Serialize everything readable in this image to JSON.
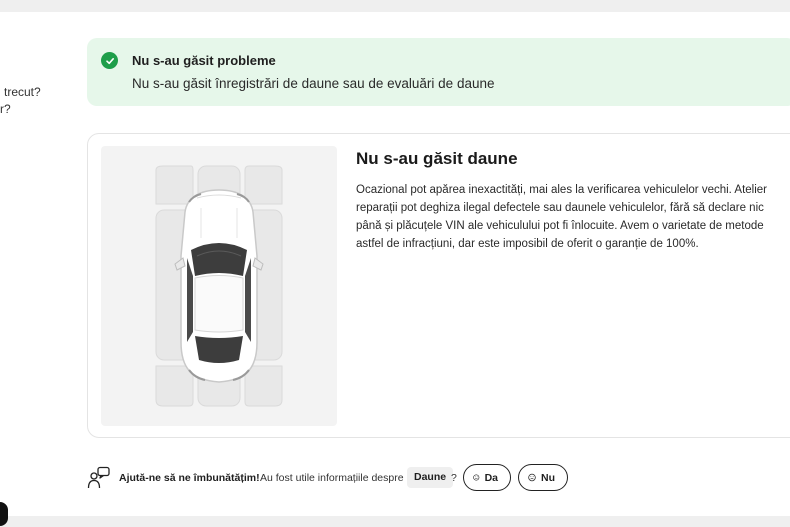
{
  "left_partial": {
    "line1": "n trecut?",
    "line2": "r?"
  },
  "alert": {
    "title": "Nu s-au găsit probleme",
    "text": "Nu s-au găsit înregistrări de daune sau de evaluări de daune",
    "accent": "#1e9e4a",
    "background": "#e6f7ea"
  },
  "card": {
    "title": "Nu s-au găsit daune",
    "lines": [
      "Ocazional pot apărea inexactități, mai ales la verificarea vehiculelor vechi. Atelier",
      "reparații pot deghiza ilegal defectele sau daunele vehiculelor, fără să declare nic",
      "până și plăcuțele VIN ale vehiculului pot fi înlocuite. Avem o varietate de metode",
      "astfel de infracțiuni, dar este imposibil de oferit o garanție de 100%."
    ]
  },
  "feedback": {
    "bold": "Ajută-ne să ne îmbunătățim!",
    "question": "Au fost utile informațiile despre",
    "chip": "Daune",
    "qmark": "?",
    "yes_label": "Da",
    "no_label": "Nu"
  }
}
